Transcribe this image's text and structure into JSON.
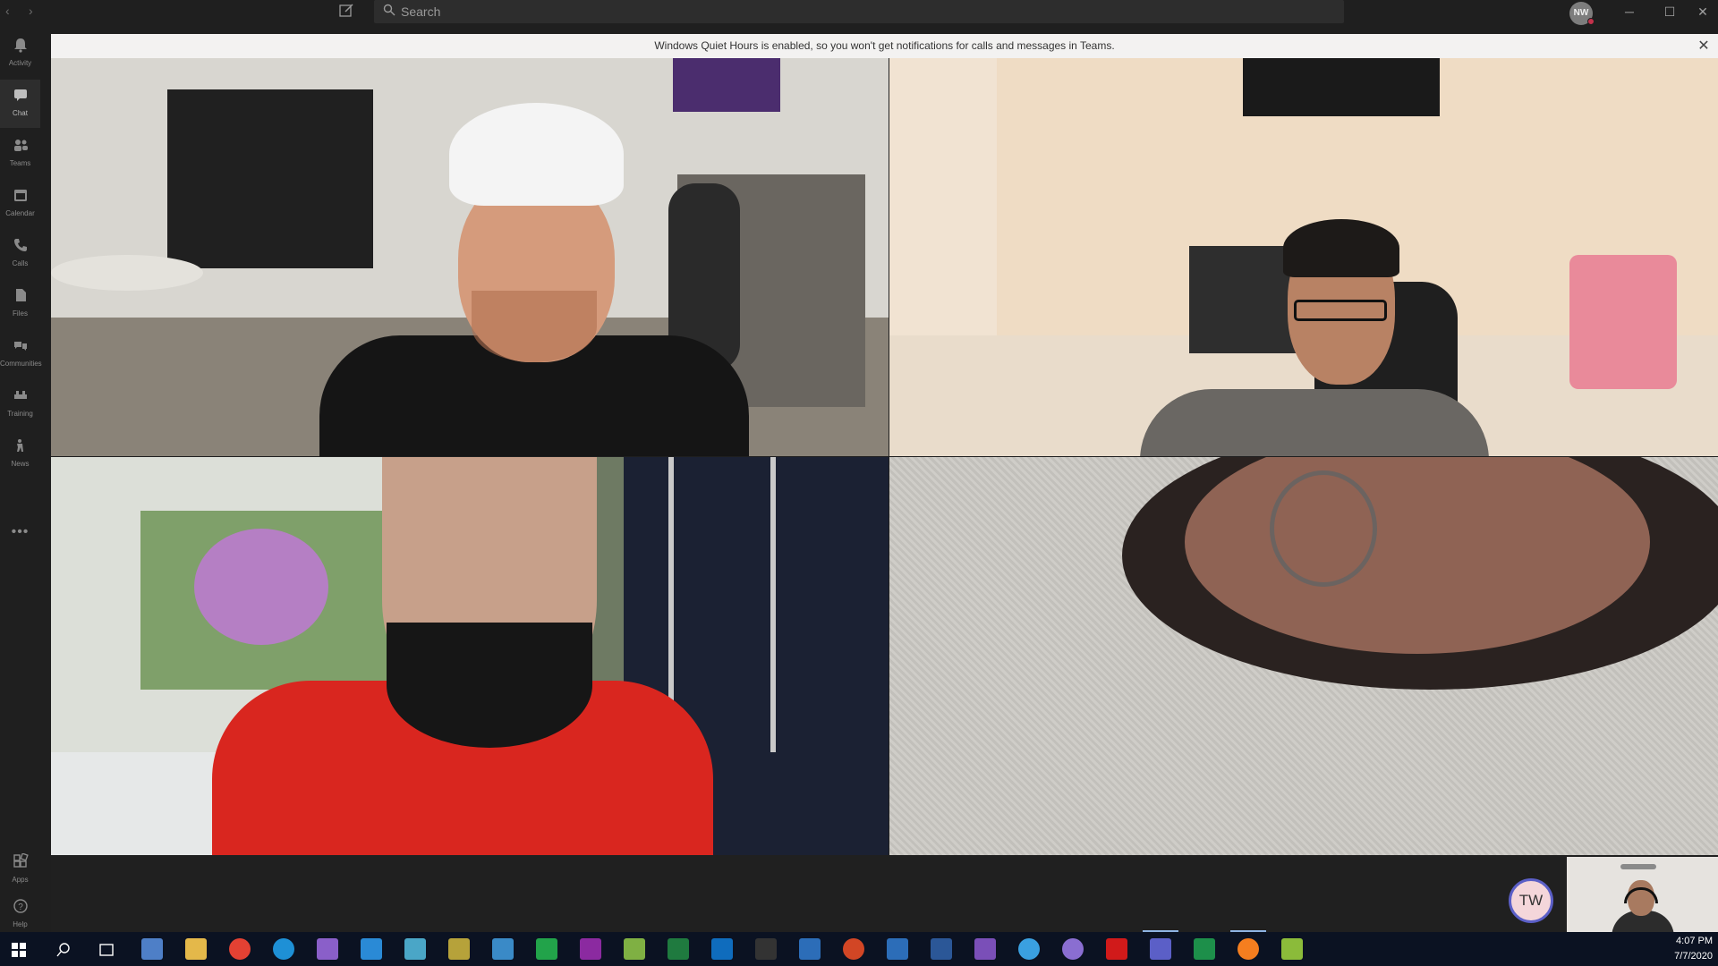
{
  "titlebar": {
    "search_placeholder": "Search",
    "me_initials": "NW",
    "minimize": "─",
    "maximize": "☐",
    "close": "✕"
  },
  "rail": {
    "items": [
      {
        "label": "Activity",
        "icon": "bell-icon"
      },
      {
        "label": "Chat",
        "icon": "chat-icon"
      },
      {
        "label": "Teams",
        "icon": "teams-icon"
      },
      {
        "label": "Calendar",
        "icon": "calendar-icon"
      },
      {
        "label": "Calls",
        "icon": "phone-icon"
      },
      {
        "label": "Files",
        "icon": "file-icon"
      },
      {
        "label": "Communities",
        "icon": "communities-icon"
      },
      {
        "label": "Training",
        "icon": "training-icon"
      },
      {
        "label": "News",
        "icon": "news-icon"
      }
    ],
    "more": "•••",
    "apps_label": "Apps",
    "help_label": "Help"
  },
  "banner": {
    "text": "Windows Quiet Hours is enabled, so you won't get notifications for calls and messages in Teams.",
    "close": "✕"
  },
  "call": {
    "participant_initials": "TW"
  },
  "taskbar": {
    "time": "4:07 PM",
    "date": "7/7/2020",
    "accent": "#0b1222"
  }
}
